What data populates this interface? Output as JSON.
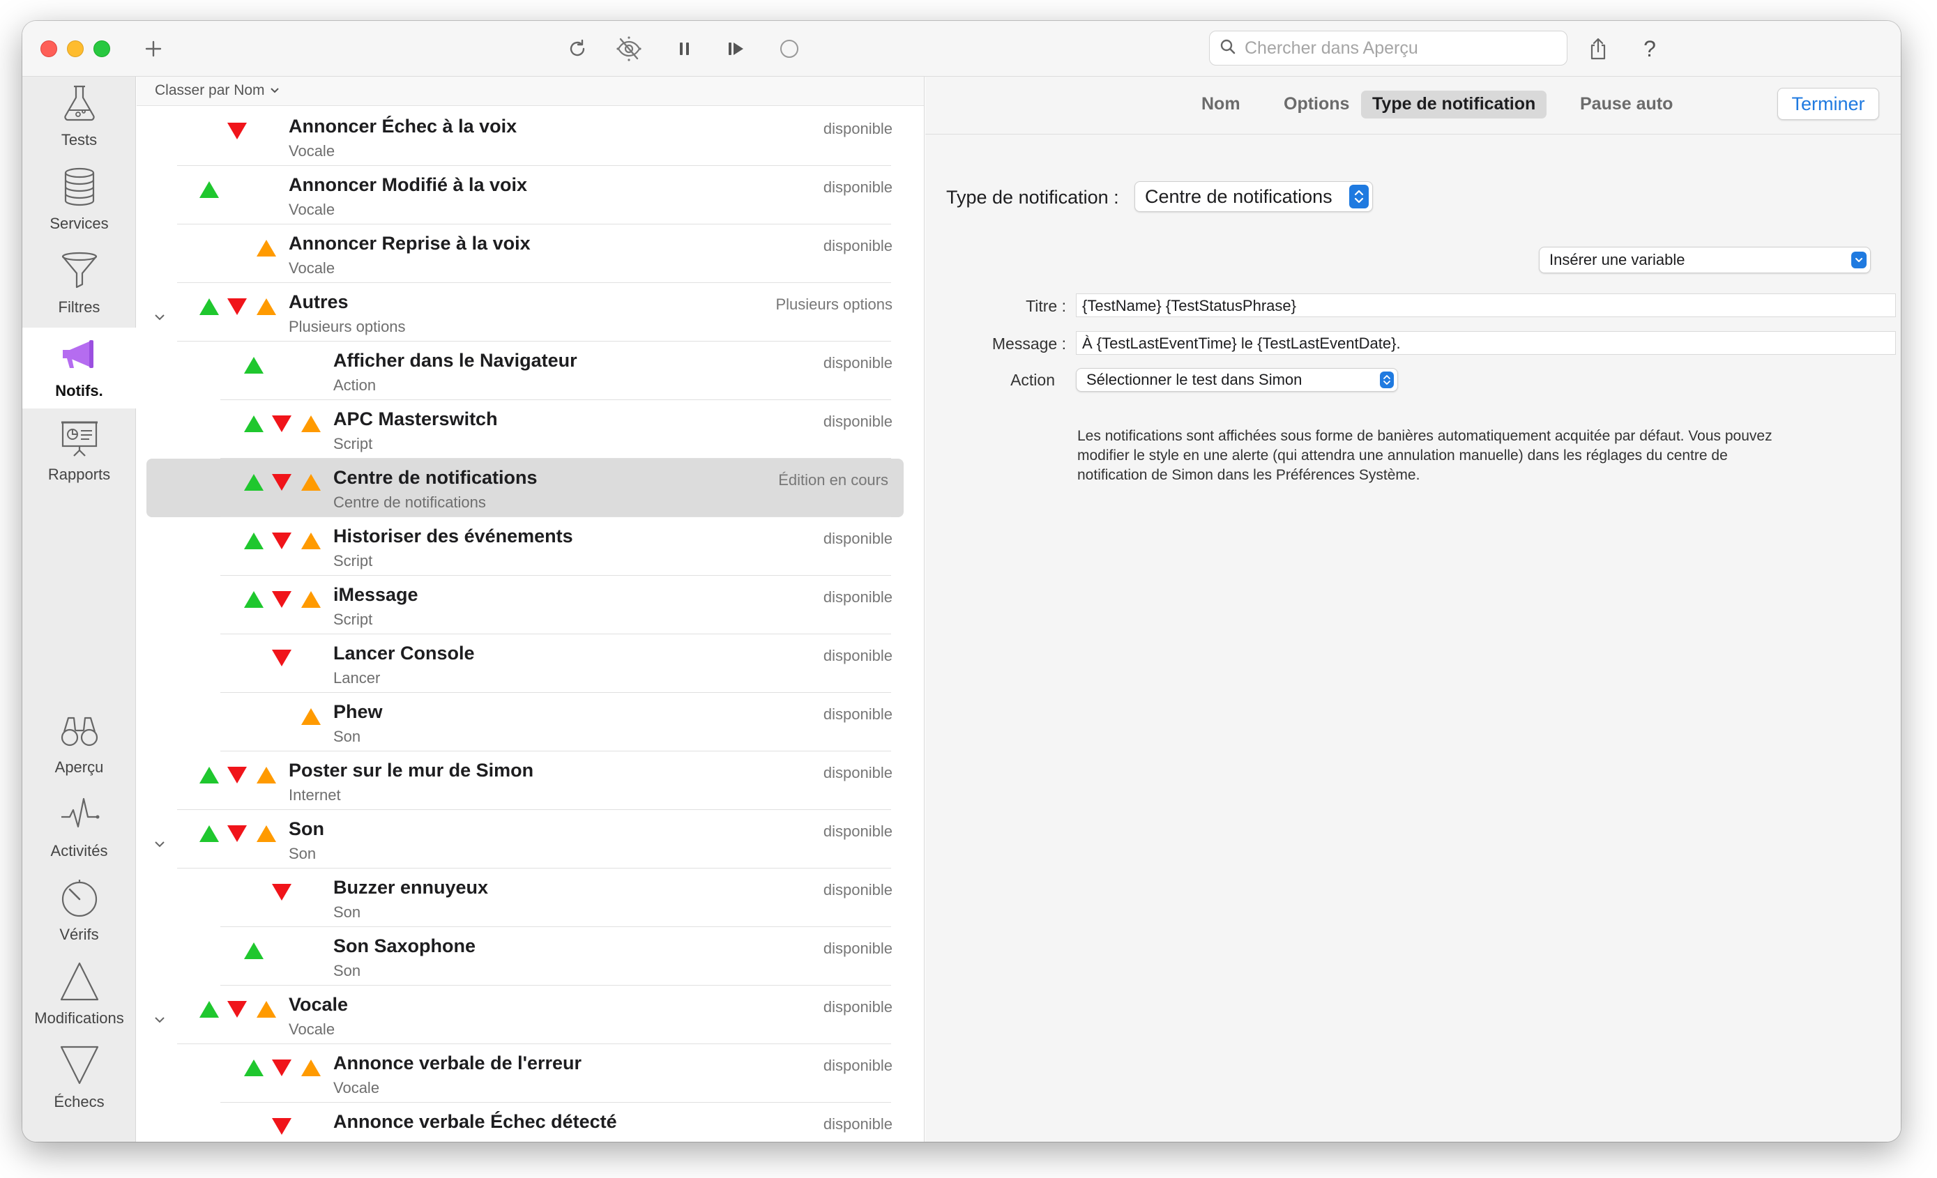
{
  "toolbar": {
    "search_placeholder": "Chercher dans Aperçu",
    "icons": [
      "plus-icon",
      "refresh-icon",
      "disabled-eye-icon",
      "pause-icon",
      "step-forward-icon",
      "circle-icon",
      "share-icon",
      "help-icon"
    ],
    "help_glyph": "?"
  },
  "sidebar": {
    "items": [
      {
        "label": "Tests",
        "icon": "flask-icon"
      },
      {
        "label": "Services",
        "icon": "database-icon"
      },
      {
        "label": "Filtres",
        "icon": "funnel-icon"
      },
      {
        "label": "Notifs.",
        "icon": "megaphone-icon",
        "active": true
      },
      {
        "label": "Rapports",
        "icon": "presentation-icon"
      },
      {
        "label": "Aperçu",
        "icon": "binoculars-icon"
      },
      {
        "label": "Activités",
        "icon": "pulse-icon"
      },
      {
        "label": "Vérifs",
        "icon": "timer-icon"
      },
      {
        "label": "Modifications",
        "icon": "triangle-up-icon"
      },
      {
        "label": "Échecs",
        "icon": "triangle-down-icon"
      }
    ]
  },
  "list": {
    "sort_label": "Classer par Nom",
    "rows": [
      {
        "title": "Annoncer Échec à la voix",
        "sub": "Vocale",
        "status": "disponible",
        "tris": [
          "red"
        ]
      },
      {
        "title": "Annoncer Modifié à la voix",
        "sub": "Vocale",
        "status": "disponible",
        "tris": [
          "green"
        ]
      },
      {
        "title": "Annoncer Reprise à la voix",
        "sub": "Vocale",
        "status": "disponible",
        "tris": [
          "orange"
        ]
      },
      {
        "title": "Autres",
        "sub": "Plusieurs options",
        "status": "Plusieurs options",
        "tris": [
          "green",
          "red",
          "orange"
        ],
        "group": true
      },
      {
        "title": "Afficher dans le Navigateur",
        "sub": "Action",
        "status": "disponible",
        "tris": [
          "green"
        ]
      },
      {
        "title": "APC Masterswitch",
        "sub": "Script",
        "status": "disponible",
        "tris": [
          "green",
          "red",
          "orange"
        ]
      },
      {
        "title": "Centre de notifications",
        "sub": "Centre de notifications",
        "status": "Édition en cours",
        "tris": [
          "green",
          "red",
          "orange"
        ],
        "selected": true
      },
      {
        "title": "Historiser des événements",
        "sub": "Script",
        "status": "disponible",
        "tris": [
          "green",
          "red",
          "orange"
        ]
      },
      {
        "title": "iMessage",
        "sub": "Script",
        "status": "disponible",
        "tris": [
          "green",
          "red",
          "orange"
        ]
      },
      {
        "title": "Lancer Console",
        "sub": "Lancer",
        "status": "disponible",
        "tris": [
          "red"
        ]
      },
      {
        "title": "Phew",
        "sub": "Son",
        "status": "disponible",
        "tris": [
          "orange"
        ]
      },
      {
        "title": "Poster sur le mur de Simon",
        "sub": "Internet",
        "status": "disponible",
        "tris": [
          "green",
          "red",
          "orange"
        ]
      },
      {
        "title": "Son",
        "sub": "Son",
        "status": "disponible",
        "tris": [
          "green",
          "red",
          "orange"
        ],
        "group": true
      },
      {
        "title": "Buzzer ennuyeux",
        "sub": "Son",
        "status": "disponible",
        "tris": [
          "red"
        ]
      },
      {
        "title": "Son Saxophone",
        "sub": "Son",
        "status": "disponible",
        "tris": [
          "green"
        ]
      },
      {
        "title": "Vocale",
        "sub": "Vocale",
        "status": "disponible",
        "tris": [
          "green",
          "red",
          "orange"
        ],
        "group": true
      },
      {
        "title": "Annonce verbale de l'erreur",
        "sub": "Vocale",
        "status": "disponible",
        "tris": [
          "green",
          "red",
          "orange"
        ]
      },
      {
        "title": "Annonce verbale Échec détecté",
        "sub": "",
        "status": "disponible",
        "tris": [
          "red"
        ]
      }
    ]
  },
  "detail": {
    "tabs": [
      "Nom",
      "Options",
      "Type de notification",
      "Pause auto"
    ],
    "active_tab": "Type de notification",
    "done_label": "Terminer",
    "type_label": "Type de notification :",
    "type_value": "Centre de notifications",
    "insert_variable": "Insérer une variable",
    "title_label": "Titre :",
    "title_value": "{TestName} {TestStatusPhrase}",
    "message_label": "Message :",
    "message_value": "À {TestLastEventTime} le {TestLastEventDate}.",
    "action_label": "Action",
    "action_value": "Sélectionner le test dans Simon",
    "help_text": "Les notifications sont affichées sous forme de banières automatiquement acquitée par défaut. Vous pouvez modifier le style en une alerte (qui attendra une annulation manuelle) dans les réglages du centre de notification de Simon dans les Préférences Système."
  },
  "colors": {
    "green": "#1fc72e",
    "red": "#f0141a",
    "orange": "#ff9a00",
    "accent": "#1f7ae0",
    "notifs_purple": "#b56cf0"
  }
}
